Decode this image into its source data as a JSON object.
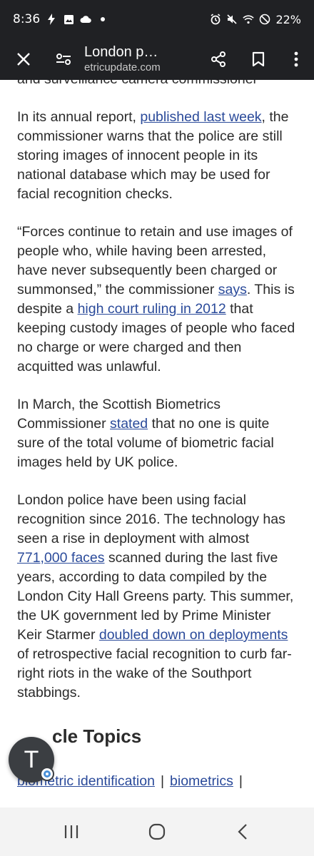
{
  "status_bar": {
    "time": "8:36",
    "battery": "22%",
    "icons": [
      "flash-icon",
      "image-icon",
      "cloud-icon",
      "dot-icon",
      "alarm-icon",
      "mute-icon",
      "wifi-icon",
      "dnd-icon"
    ]
  },
  "toolbar": {
    "title": "London p…",
    "url": "etricupdate.com",
    "icons": [
      "close-icon",
      "tune-icon",
      "share-icon",
      "bookmark-icon",
      "more-icon"
    ]
  },
  "article": {
    "partial_line": "and surveillance camera commissioner office.",
    "p1": {
      "before": "In its annual report, ",
      "link": "published last week",
      "after": ", the commissioner warns that the police are still storing images of innocent people in its national database which may be used for facial recognition checks."
    },
    "p2": {
      "before": "“Forces continue to retain and use images of people who, while having been arrested, have never subsequently been charged or summonsed,” the commissioner ",
      "link1": "says",
      "middle": ". This is despite a ",
      "link2": "high court ruling in 2012",
      "after": " that keeping custody images of people who faced no charge or were charged and then acquitted was unlawful."
    },
    "p3": {
      "before": "In March, the Scottish Biometrics Commissioner ",
      "link": "stated",
      "after": " that no one is quite sure of the total volume of biometric facial images held by UK police."
    },
    "p4": {
      "before": "London police have been using facial recognition since 2016. The technology has seen a rise in deployment with almost ",
      "link1": "771,000 faces",
      "middle": " scanned during the last five years, according to data compiled by the London City Hall Greens party. This summer, the UK government led by Prime Minister Keir Starmer ",
      "link2": "doubled down on deployments",
      "after": " of retrospective facial recognition to curb far-right riots in the wake of the Southport stabbings."
    },
    "topics_heading": "cle Topics",
    "topics": [
      "biometric identification",
      "biometrics"
    ],
    "separator": "|"
  },
  "avatar": {
    "letter": "T"
  },
  "navbar": {
    "icons": [
      "recent-apps-icon",
      "home-icon",
      "back-icon"
    ]
  }
}
